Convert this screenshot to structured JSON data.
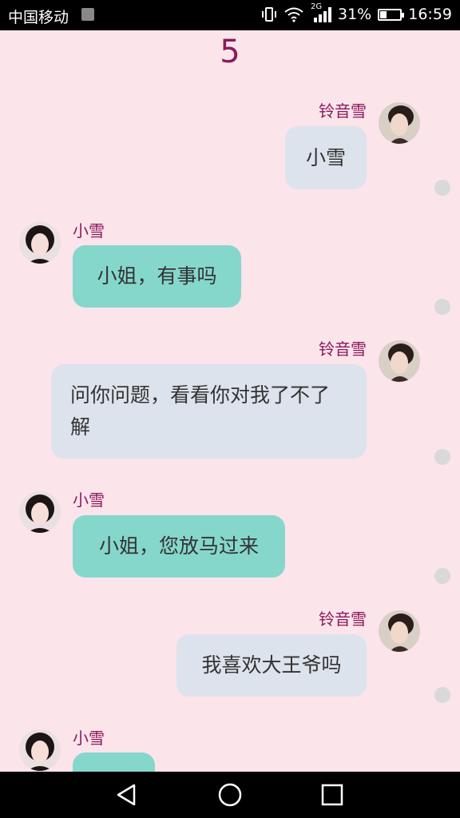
{
  "status_bar": {
    "carrier": "中国移动",
    "network": "2G",
    "battery": "31%",
    "time": "16:59"
  },
  "counter": "5",
  "messages": [
    {
      "sender": "铃音雪",
      "side": "right",
      "text": "小雪"
    },
    {
      "sender": "小雪",
      "side": "left",
      "text": "小姐，有事吗"
    },
    {
      "sender": "铃音雪",
      "side": "right",
      "text": "问你问题，看看你对我了不了解"
    },
    {
      "sender": "小雪",
      "side": "left",
      "text": "小姐，您放马过来"
    },
    {
      "sender": "铃音雪",
      "side": "right",
      "text": "我喜欢大王爷吗"
    },
    {
      "sender": "小雪",
      "side": "left",
      "text": ""
    }
  ],
  "colors": {
    "background": "#fbe4ea",
    "name": "#8b1a5c",
    "bubble_me": "#dde3ec",
    "bubble_other": "#86d7cb"
  }
}
